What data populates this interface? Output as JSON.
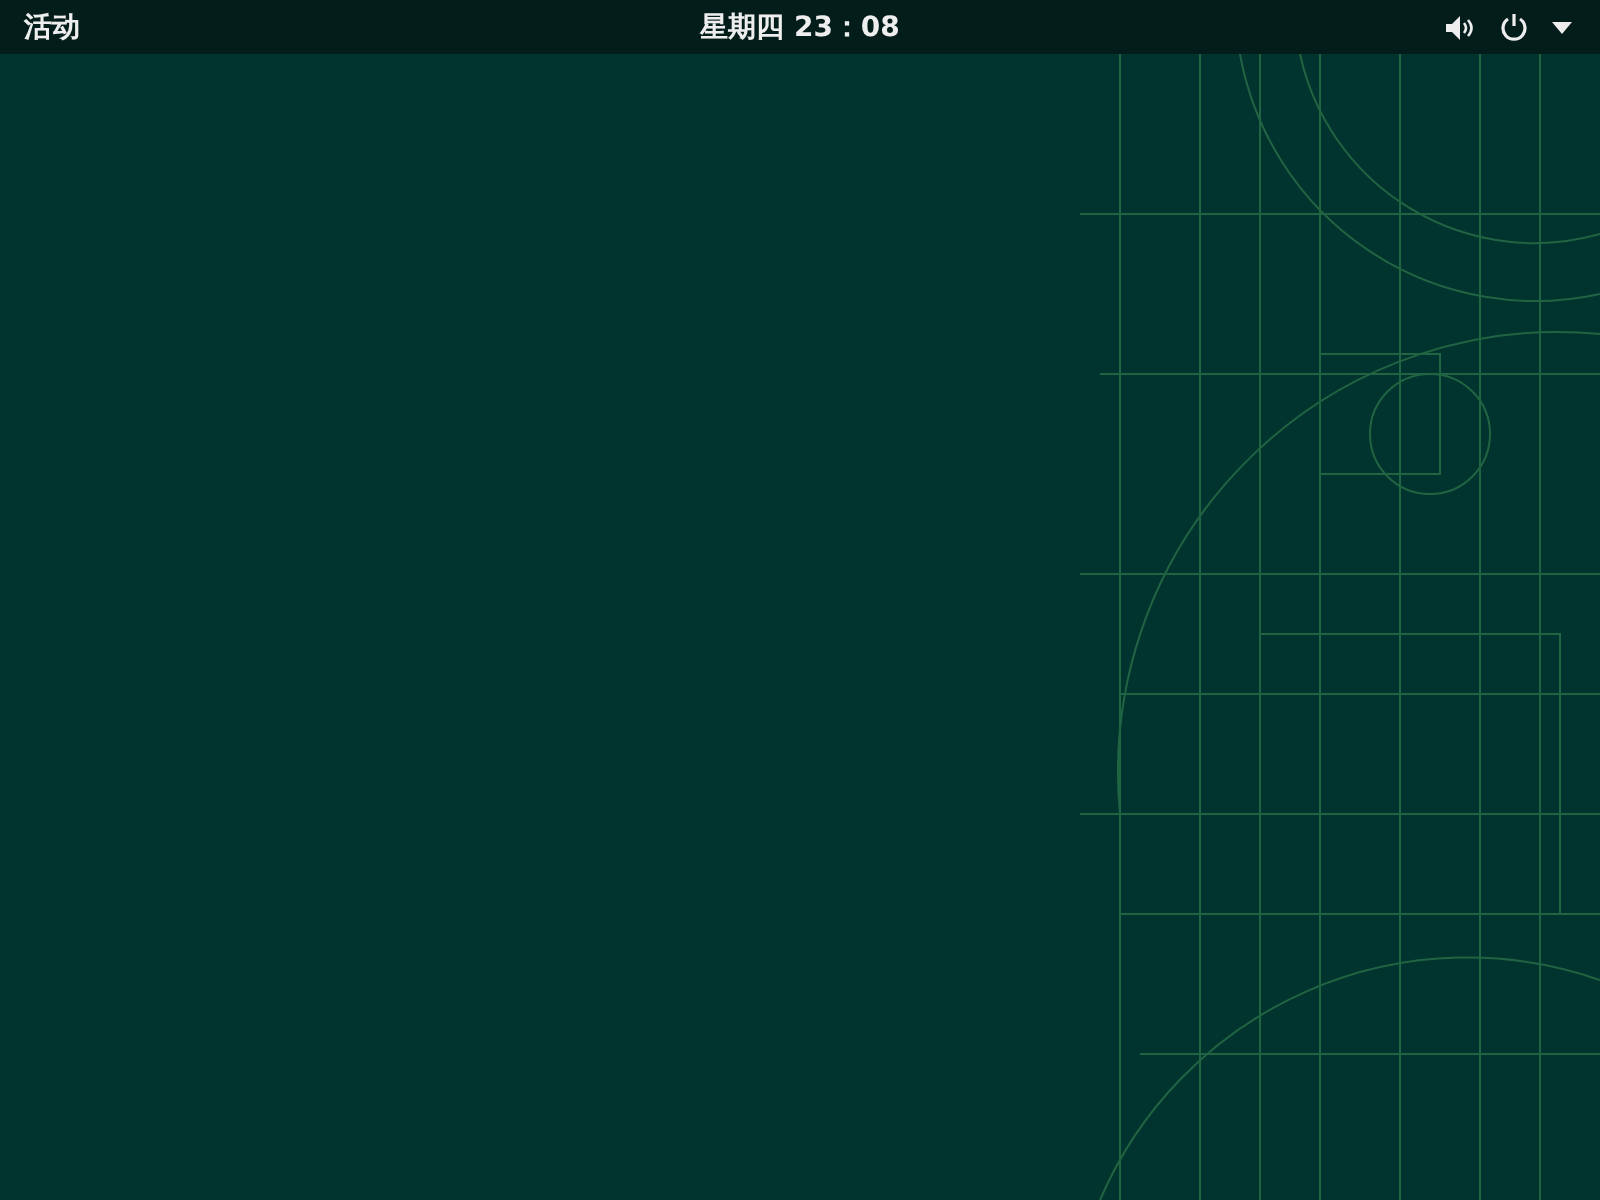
{
  "top_bar": {
    "activities": "活动",
    "clock": "星期四 23：08"
  }
}
